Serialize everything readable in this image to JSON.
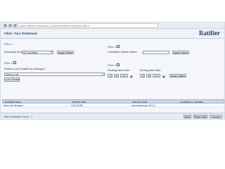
{
  "browser": {
    "url": "www.ratifier.com/admin_v2/search/filter.php?jobid=3844"
  },
  "header": {
    "title": "Filter: Your Download",
    "logo": "Ratifier"
  },
  "filters": {
    "filter1": {
      "label": "Filter 1",
      "download_area_label": "Download Area:",
      "download_area_value": "All Candidate",
      "apply_label": "Apply Criteria"
    },
    "filter2": {
      "label": "Filter 2",
      "search_label": "Candidate Search Name:",
      "apply_label": "Apply Criteria"
    },
    "filter3": {
      "label": "Filter 3",
      "list_label": "Select a List Created by colleague:",
      "list_value": "Select a List",
      "load_label": "Load Shortlist"
    },
    "filter4": {
      "label": "Filter 4",
      "start_label": "Starting New Date",
      "end_label": "Ending New Date",
      "start_day": "18",
      "start_month": "08",
      "start_year": "2013",
      "end_day": "28",
      "end_month": "08",
      "end_year": "2013",
      "apply_label": "Apply Criteria"
    }
  },
  "table": {
    "headers": [
      "Candidate Name",
      "Interview Date",
      "Interview Code",
      "Candidate on marklaba"
    ],
    "rows": [
      [
        "Momo the Dinosaur",
        "2013-08-28",
        "new experience 2013 Q",
        ""
      ]
    ]
  },
  "footer": {
    "found_text": "Total Candidate Found : 1",
    "back_label": "Back",
    "reset_label": "Reset Filter",
    "proceed_label": "Proceed"
  }
}
